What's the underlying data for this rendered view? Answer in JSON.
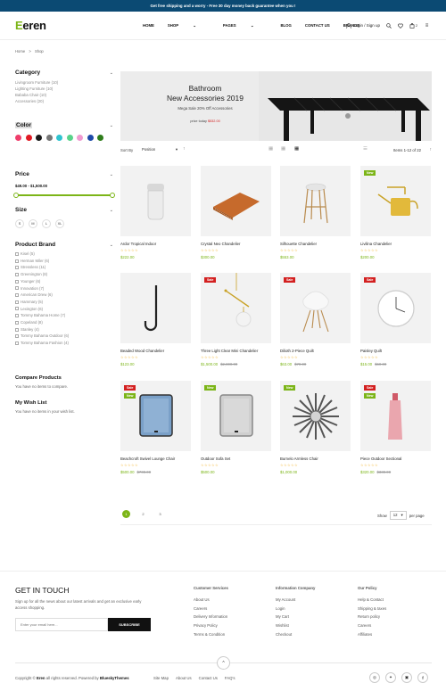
{
  "topbar": {
    "text": "Get free shipping and a worry - Free 30 day money back guarantee when you !"
  },
  "header": {
    "logo": {
      "first": "E",
      "rest": "eren"
    },
    "nav": [
      "HOME",
      "SHOP",
      "PAGES",
      "BLOG",
      "CONTACT US",
      "BRANDS"
    ],
    "login": "Login / Sign up",
    "cart_count": "2"
  },
  "breadcrumb": {
    "home": "Home",
    "sep": ">",
    "current": "Shop"
  },
  "sidebar": {
    "category_title": "Category",
    "categories": [
      "Livingroom Furniture (10)",
      "Lighting Furniture (10)",
      "Bababa Chair (10)",
      "Accessories (20)"
    ],
    "color_title": "Color",
    "colors": [
      "#ef3e6b",
      "#e01b24",
      "#1a1a1a",
      "#777777",
      "#2fc3cf",
      "#59d38a",
      "#f09ad0",
      "#1e4aa8",
      "#2e7d1b"
    ],
    "price_title": "Price",
    "price_range": "$49.00 - $1,500.00",
    "price_fill": 1.0,
    "size_title": "Size",
    "sizes": [
      "S",
      "M",
      "L",
      "XL"
    ],
    "brand_title": "Product Brand",
    "brands": [
      "Kisel (5)",
      "Herman Miler (6)",
      "Stressless (11)",
      "Greenington (8)",
      "Younger (6)",
      "Innovation (7)",
      "American Drew (6)",
      "Hammary (5)",
      "Lexington (6)",
      "Tommy Bahama Home (7)",
      "Copeland (8)",
      "Stanley (4)",
      "Tommy Bahama Outdoor (6)",
      "Tommy Bahama Fashion (4)"
    ],
    "compare_title": "Compare Products",
    "compare_text": "You have no items to compare.",
    "wish_title": "My Wish List",
    "wish_text": "You have no items in your wish list."
  },
  "banner": {
    "title1": "Bathroom",
    "title2": "New Accessories 2019",
    "subtitle": "Mega Sale 20% Off Accessories",
    "price_label": "price today",
    "price": "$532.00"
  },
  "toolbar": {
    "sort_label": "Sort By",
    "sort_value": "Position",
    "items": "Items 1-12 of 22"
  },
  "products": [
    {
      "name": "Ardor Tropical Indoor",
      "price": "$222.00",
      "old": "",
      "badges": []
    },
    {
      "name": "Crystal Neo Chandelier",
      "price": "$300.00",
      "old": "",
      "badges": []
    },
    {
      "name": "Silhouette Chandelier",
      "price": "$553.00",
      "old": "",
      "badges": []
    },
    {
      "name": "Livilina Chandelier",
      "price": "$200.00",
      "old": "",
      "badges": [
        "New"
      ]
    },
    {
      "name": "Beaded Wood Chandelier",
      "price": "$123.00",
      "old": "",
      "badges": []
    },
    {
      "name": "Three Light Clear Mini Chandelier",
      "price": "$1,500.00",
      "old": "$2,800.00",
      "badges": [
        "Sale"
      ]
    },
    {
      "name": "Dilioth 2-Piece Quilt",
      "price": "$63.00",
      "old": "$70.00",
      "badges": [
        "Sale"
      ]
    },
    {
      "name": "Paisley Quilt",
      "price": "$15.00",
      "old": "$60.00",
      "badges": [
        "Sale"
      ]
    },
    {
      "name": "Beachcroft Swivel Lounge Chair",
      "price": "$500.00",
      "old": "$700.00",
      "badges": [
        "Sale",
        "New"
      ]
    },
    {
      "name": "Outdoor Sofa Set",
      "price": "$500.00",
      "old": "",
      "badges": [
        "New"
      ]
    },
    {
      "name": "Burnelo Armless Chair",
      "price": "$1,000.00",
      "old": "",
      "badges": [
        "New"
      ]
    },
    {
      "name": "Piece Outdoor Sectional",
      "price": "$320.00",
      "old": "$330.00",
      "badges": [
        "Sale",
        "New"
      ]
    }
  ],
  "pager": {
    "pages": [
      "1",
      "2",
      "3"
    ],
    "show_label": "Show",
    "show_value": "12",
    "per_page": "per page"
  },
  "footer": {
    "get_in_touch": "GET IN TOUCH",
    "touch_text": "Sign up for all the news about our latest arrivals and get an exclusive early access shopping.",
    "email_placeholder": "Enter your email here...",
    "subscribe": "SUBSCRIBE",
    "col1_title": "Customer Services",
    "col1": [
      "About Us",
      "Careers",
      "Delivery Information",
      "Privacy Policy",
      "Terms & Condition"
    ],
    "col2_title": "Information Company",
    "col2": [
      "My Account",
      "Login",
      "My Cart",
      "Wishlist",
      "Checkout"
    ],
    "col3_title": "Our Policy",
    "col3": [
      "Help & Contact",
      "Shipping & taxes",
      "Return policy",
      "Careers",
      "Affiliates"
    ],
    "copyright_a": "Copyright ©",
    "copyright_brand": "Eren",
    "copyright_b": "all rights reserved. Powered by",
    "copyright_by": "BlueskyThemes",
    "links": [
      "Site Map",
      "About Us",
      "Contact Us",
      "FAQ's"
    ]
  }
}
